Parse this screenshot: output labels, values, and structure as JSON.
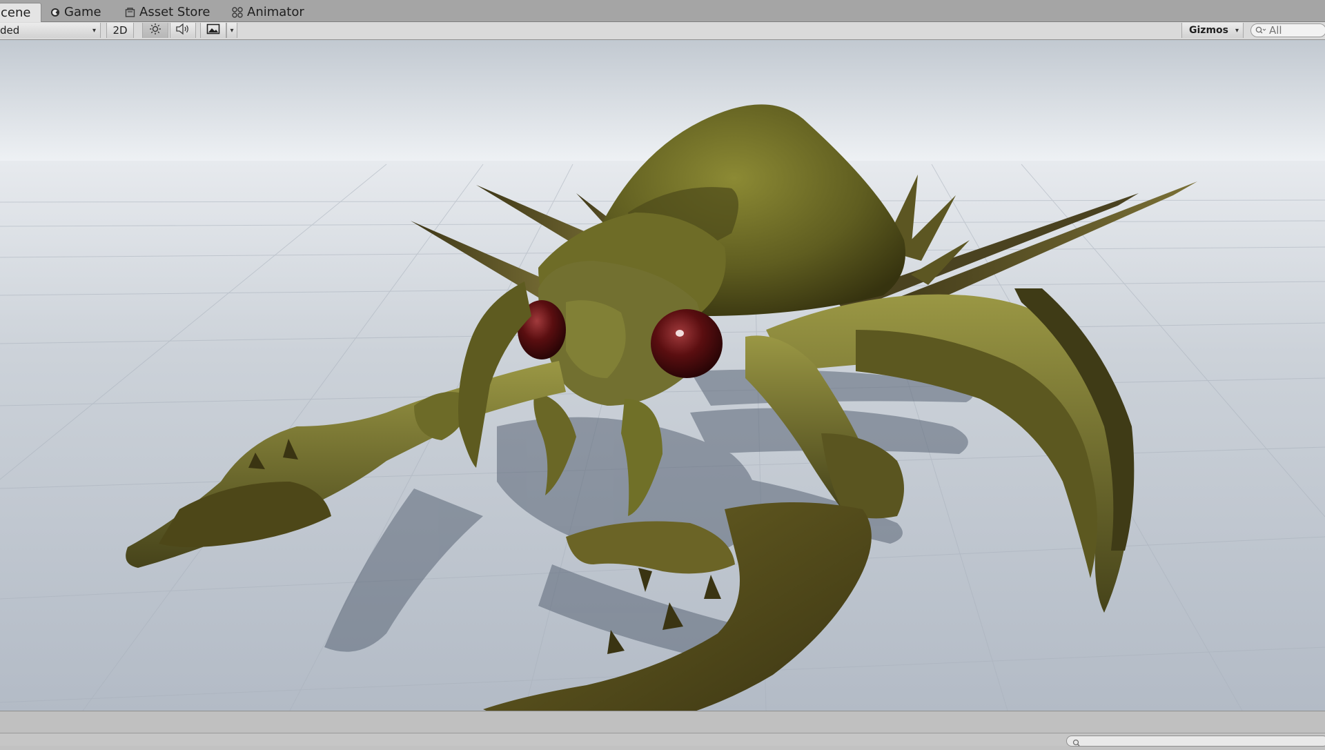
{
  "tabs": [
    {
      "label": "cene",
      "icon": "scene-icon",
      "active": true
    },
    {
      "label": "Game",
      "icon": "game-icon",
      "active": false
    },
    {
      "label": "Asset Store",
      "icon": "asset-store-icon",
      "active": false
    },
    {
      "label": "Animator",
      "icon": "animator-icon",
      "active": false
    }
  ],
  "toolbar": {
    "shading_mode": "ded",
    "mode_2d": "2D",
    "lighting_icon": "sun-icon",
    "audio_icon": "speaker-icon",
    "effects_icon": "image-icon",
    "gizmos_label": "Gizmos",
    "search_placeholder": "All"
  },
  "scene": {
    "subject": "creature-model",
    "colors": {
      "sky_top": "#c4cbd3",
      "horizon": "#eef1f4",
      "ground": "#b7bfc9",
      "creature_body": "#6b6a22",
      "creature_dark": "#3e3a14",
      "eye": "#5a0e10"
    }
  },
  "colors": {
    "tabbar": "#a5a5a5",
    "toolbar": "#dadada",
    "statusbar": "#c0c0c0"
  }
}
